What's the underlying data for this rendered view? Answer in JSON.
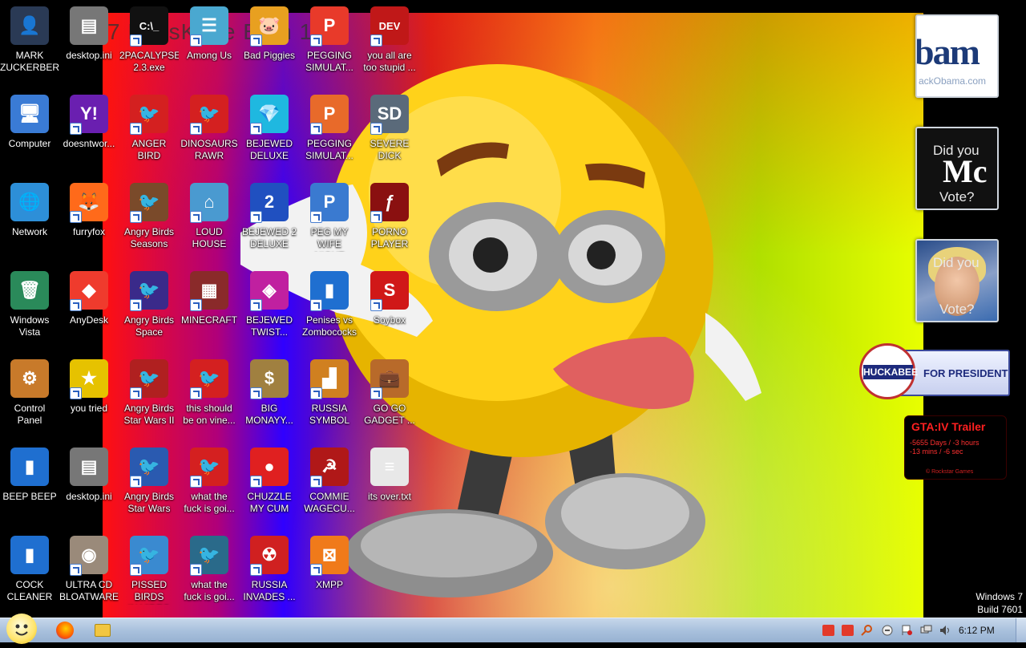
{
  "wallpaper": {
    "title": "7 BossKa ie E on 12"
  },
  "desktop_icons": [
    {
      "label": "MARK\nZUCKERBERG",
      "icon": "user-folder-icon",
      "color": "#2a3a55",
      "glyph": "👤",
      "shortcut": false,
      "col": 0,
      "row": 0
    },
    {
      "label": "Computer",
      "icon": "computer-icon",
      "color": "#3a7bd5",
      "glyph": "🖥",
      "shortcut": false,
      "col": 0,
      "row": 1
    },
    {
      "label": "Network",
      "icon": "network-icon",
      "color": "#2d8fd8",
      "glyph": "🌐",
      "shortcut": false,
      "col": 0,
      "row": 2
    },
    {
      "label": "Windows\nVista",
      "icon": "recycle-bin-icon",
      "color": "#2a8a5a",
      "glyph": "🗑",
      "shortcut": false,
      "col": 0,
      "row": 3
    },
    {
      "label": "Control\nPanel",
      "icon": "control-panel-icon",
      "color": "#c87a2a",
      "glyph": "⚙",
      "shortcut": false,
      "col": 0,
      "row": 4
    },
    {
      "label": "BEEP BEEP",
      "icon": "blue-file-icon",
      "color": "#1f6fd0",
      "glyph": "▮",
      "shortcut": false,
      "col": 0,
      "row": 5
    },
    {
      "label": "COCK\nCLEANER",
      "icon": "blue-file-icon",
      "color": "#1f6fd0",
      "glyph": "▮",
      "shortcut": false,
      "col": 0,
      "row": 6
    },
    {
      "label": "desktop.ini",
      "icon": "settings-file-icon",
      "color": "#777",
      "glyph": "▤",
      "shortcut": false,
      "col": 1,
      "row": 0
    },
    {
      "label": "doesntwor...",
      "icon": "yahoo-messenger-icon",
      "color": "#6a1fb0",
      "glyph": "Y!",
      "shortcut": true,
      "col": 1,
      "row": 1
    },
    {
      "label": "furryfox",
      "icon": "firefox-icon",
      "color": "#ff6a1a",
      "glyph": "🦊",
      "shortcut": true,
      "col": 1,
      "row": 2
    },
    {
      "label": "AnyDesk",
      "icon": "anydesk-icon",
      "color": "#ef3b2d",
      "glyph": "◆",
      "shortcut": true,
      "col": 1,
      "row": 3
    },
    {
      "label": "you tried",
      "icon": "star-icon",
      "color": "#e6c200",
      "glyph": "★",
      "shortcut": true,
      "col": 1,
      "row": 4
    },
    {
      "label": "desktop.ini",
      "icon": "settings-file-icon",
      "color": "#777",
      "glyph": "▤",
      "shortcut": false,
      "col": 1,
      "row": 5
    },
    {
      "label": "ULTRA CD\nBLOATWARE",
      "icon": "cd-icon",
      "color": "#9a8a7a",
      "glyph": "◉",
      "shortcut": true,
      "col": 1,
      "row": 6
    },
    {
      "label": "2PACALYPSE\n2.3.exe",
      "icon": "cmd-icon",
      "color": "#111",
      "glyph": "C:\\_",
      "shortcut": true,
      "col": 2,
      "row": 0
    },
    {
      "label": "ANGER BIRD",
      "icon": "angry-birds-icon",
      "color": "#d42020",
      "glyph": "🐦",
      "shortcut": true,
      "col": 2,
      "row": 1
    },
    {
      "label": "Angry Birds\nSeasons",
      "icon": "angry-birds-seasons-icon",
      "color": "#7a4a2a",
      "glyph": "🐦",
      "shortcut": true,
      "col": 2,
      "row": 2
    },
    {
      "label": "Angry Birds\nSpace",
      "icon": "angry-birds-space-icon",
      "color": "#3a2a8a",
      "glyph": "🐦",
      "shortcut": true,
      "col": 2,
      "row": 3
    },
    {
      "label": "Angry Birds\nStar Wars II",
      "icon": "angry-birds-star-wars-icon",
      "color": "#b02020",
      "glyph": "🐦",
      "shortcut": true,
      "col": 2,
      "row": 4
    },
    {
      "label": "Angry Birds\nStar Wars",
      "icon": "angry-birds-star-wars-icon",
      "color": "#2a5ab0",
      "glyph": "🐦",
      "shortcut": true,
      "col": 2,
      "row": 5
    },
    {
      "label": "PISSED BIRDS\nIN VIDEO G...",
      "icon": "angry-birds-icon",
      "color": "#3a8ad0",
      "glyph": "🐦",
      "shortcut": true,
      "col": 2,
      "row": 6
    },
    {
      "label": "Among Us",
      "icon": "among-us-icon",
      "color": "#4aa8d0",
      "glyph": "☰",
      "shortcut": true,
      "col": 3,
      "row": 0
    },
    {
      "label": "DINOSAURS\nRAWR",
      "icon": "angry-birds-icon",
      "color": "#d42020",
      "glyph": "🐦",
      "shortcut": true,
      "col": 3,
      "row": 1
    },
    {
      "label": "LOUD\nHOUSE",
      "icon": "loud-house-icon",
      "color": "#4a9ad0",
      "glyph": "⌂",
      "shortcut": true,
      "col": 3,
      "row": 2
    },
    {
      "label": "MINECRAFT",
      "icon": "minecraft-icon",
      "color": "#8a2a2a",
      "glyph": "▦",
      "shortcut": true,
      "col": 3,
      "row": 3
    },
    {
      "label": "this should\nbe on vine...",
      "icon": "angry-birds-icon",
      "color": "#d42020",
      "glyph": "🐦",
      "shortcut": true,
      "col": 3,
      "row": 4
    },
    {
      "label": "what the\nfuck is goi...",
      "icon": "angry-birds-icon",
      "color": "#d42020",
      "glyph": "🐦",
      "shortcut": true,
      "col": 3,
      "row": 5
    },
    {
      "label": "what the\nfuck is goi...",
      "icon": "angry-birds-space-icon",
      "color": "#2a6a8a",
      "glyph": "🐦",
      "shortcut": true,
      "col": 3,
      "row": 6
    },
    {
      "label": "Bad Piggies",
      "icon": "bad-piggies-icon",
      "color": "#e8a020",
      "glyph": "🐷",
      "shortcut": true,
      "col": 4,
      "row": 0
    },
    {
      "label": "BEJEWED\nDELUXE",
      "icon": "bejeweled-icon",
      "color": "#1fb8e0",
      "glyph": "💎",
      "shortcut": true,
      "col": 4,
      "row": 1
    },
    {
      "label": "BEJEWED 2\nDELUXE",
      "icon": "bejeweled-2-icon",
      "color": "#2050c0",
      "glyph": "2",
      "shortcut": true,
      "col": 4,
      "row": 2
    },
    {
      "label": "BEJEWED\nTWIST...",
      "icon": "bejeweled-twist-icon",
      "color": "#c020a0",
      "glyph": "◈",
      "shortcut": true,
      "col": 4,
      "row": 3
    },
    {
      "label": "BIG\nMONAYY...",
      "icon": "money-bag-icon",
      "color": "#a08040",
      "glyph": "$",
      "shortcut": true,
      "col": 4,
      "row": 4
    },
    {
      "label": "CHUZZLE\nMY CUM",
      "icon": "chuzzle-icon",
      "color": "#e02020",
      "glyph": "●",
      "shortcut": true,
      "col": 4,
      "row": 5
    },
    {
      "label": "RUSSIA\nINVADES ...",
      "icon": "radiation-icon",
      "color": "#d02020",
      "glyph": "☢",
      "shortcut": true,
      "col": 4,
      "row": 6
    },
    {
      "label": "PEGGING\nSIMULAT...",
      "icon": "peggle-icon",
      "color": "#e83a2a",
      "glyph": "P",
      "shortcut": true,
      "col": 5,
      "row": 0
    },
    {
      "label": "PEGGING\nSIMULAT...",
      "icon": "peggle-icon",
      "color": "#e86a2a",
      "glyph": "P",
      "shortcut": true,
      "col": 5,
      "row": 1
    },
    {
      "label": "PEG MY WIFE\nNIGHT",
      "icon": "peggle-icon",
      "color": "#3a7ad0",
      "glyph": "P",
      "shortcut": true,
      "col": 5,
      "row": 2
    },
    {
      "label": "Penises vs\nZombococks",
      "icon": "blue-file-icon",
      "color": "#1f6fd0",
      "glyph": "▮",
      "shortcut": true,
      "col": 5,
      "row": 3
    },
    {
      "label": "RUSSIA\nSYMBOL",
      "icon": "russia-symbol-icon",
      "color": "#d08020",
      "glyph": "▟",
      "shortcut": true,
      "col": 5,
      "row": 4
    },
    {
      "label": "COMMIE\nWAGECU...",
      "icon": "commie-icon",
      "color": "#b01818",
      "glyph": "☭",
      "shortcut": true,
      "col": 5,
      "row": 5
    },
    {
      "label": "XMPP",
      "icon": "xampp-icon",
      "color": "#f07a1a",
      "glyph": "⊠",
      "shortcut": true,
      "col": 5,
      "row": 6
    },
    {
      "label": "you all are\ntoo stupid ...",
      "icon": "dev-cpp-icon",
      "color": "#c01818",
      "glyph": "DEV",
      "shortcut": true,
      "col": 6,
      "row": 0
    },
    {
      "label": "SEVERE DICK",
      "icon": "sd-gear-icon",
      "color": "#5a6a7a",
      "glyph": "SD",
      "shortcut": true,
      "col": 6,
      "row": 1
    },
    {
      "label": "PORNO\nPLAYER",
      "icon": "flash-player-icon",
      "color": "#8a1010",
      "glyph": "ƒ",
      "shortcut": true,
      "col": 6,
      "row": 2
    },
    {
      "label": "Soybox",
      "icon": "soybox-icon",
      "color": "#d01818",
      "glyph": "S",
      "shortcut": true,
      "col": 6,
      "row": 3
    },
    {
      "label": "GO GO\nGADGET ...",
      "icon": "briefcase-icon",
      "color": "#b86a2a",
      "glyph": "💼",
      "shortcut": true,
      "col": 6,
      "row": 4
    },
    {
      "label": "its over.txt",
      "icon": "text-file-icon",
      "color": "#e8e8e8",
      "glyph": "≡",
      "shortcut": false,
      "col": 6,
      "row": 5
    }
  ],
  "gadgets": {
    "obama": {
      "big": "bam",
      "url": "ackObama.com"
    },
    "mccain": {
      "did": "Did you",
      "mc": "Mc",
      "vote": "Vote?"
    },
    "clinton": {
      "did": "Did you",
      "vote": "Vote?"
    },
    "huckabee": {
      "name": "HUCKABEE",
      "for_president": "FOR PRESIDENT"
    },
    "gta": {
      "title": "GTA:IV  Trailer",
      "countdown": "-5655 Days / -3 hours\n-13 mins / -6 sec",
      "credit": "© Rockstar Games"
    }
  },
  "watermark": {
    "line1": "Windows 7",
    "line2": "Build 7601"
  },
  "taskbar": {
    "clock": "6:12 PM"
  },
  "colors": {
    "taskbar": "#a9c1dd",
    "label_text": "#ffffff"
  }
}
